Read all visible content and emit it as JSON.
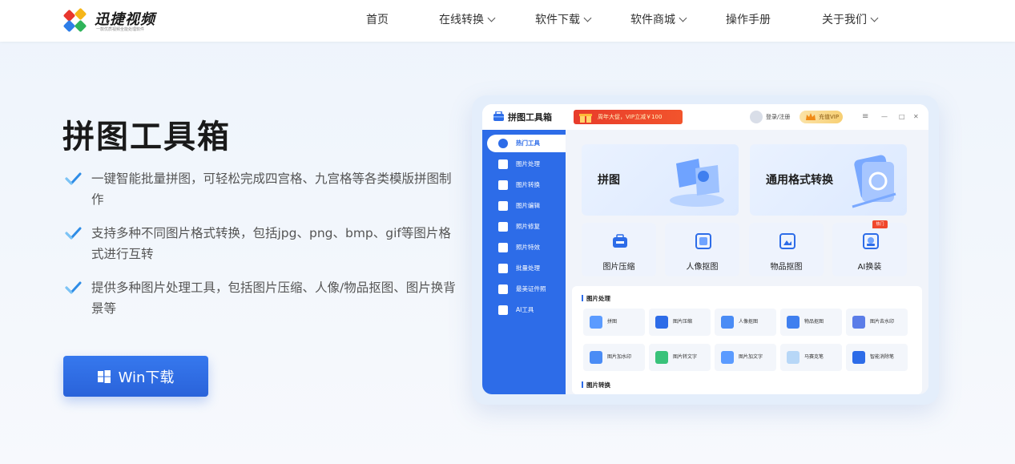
{
  "header": {
    "brand": "迅捷视频",
    "brand_tagline": "一款优质视频全能处理软件",
    "nav": [
      {
        "label": "首页",
        "has_dropdown": false
      },
      {
        "label": "在线转换",
        "has_dropdown": true
      },
      {
        "label": "软件下载",
        "has_dropdown": true
      },
      {
        "label": "软件商城",
        "has_dropdown": true
      },
      {
        "label": "操作手册",
        "has_dropdown": false
      },
      {
        "label": "关于我们",
        "has_dropdown": true
      }
    ]
  },
  "hero": {
    "title": "拼图工具箱",
    "features": [
      "一键智能批量拼图，可轻松完成四宫格、九宫格等各类模版拼图制作",
      "支持多种不同图片格式转换，包括jpg、png、bmp、gif等图片格式进行互转",
      "提供多种图片处理工具，包括图片压缩、人像/物品抠图、图片换背景等"
    ],
    "download_label": "Win下载"
  },
  "app_preview": {
    "title": "拼图工具箱",
    "promo_text": "周年大促，VIP立减￥100",
    "login_text": "登录/注册",
    "vip_text": "充值VIP",
    "window_controls": [
      "≡",
      "—",
      "□",
      "✕"
    ],
    "sidebar": [
      {
        "label": "热门工具",
        "active": true
      },
      {
        "label": "图片处理",
        "active": false
      },
      {
        "label": "图片转换",
        "active": false
      },
      {
        "label": "图片编辑",
        "active": false
      },
      {
        "label": "照片修复",
        "active": false
      },
      {
        "label": "照片特效",
        "active": false
      },
      {
        "label": "批量处理",
        "active": false
      },
      {
        "label": "最美证件照",
        "active": false
      },
      {
        "label": "AI工具",
        "active": false
      }
    ],
    "big_cards": [
      "拼图",
      "通用格式转换"
    ],
    "small_cards": [
      "图片压缩",
      "人像抠图",
      "物品抠图",
      "AI换装"
    ],
    "hot_badge": "热门",
    "section_image_processing": "图片处理",
    "tools_row1": [
      "拼图",
      "图片压缩",
      "人像抠图",
      "物品抠图",
      "图片去水印"
    ],
    "tools_row2": [
      "图片加水印",
      "图片转文字",
      "图片加文字",
      "马赛克笔",
      "智能消除笔"
    ],
    "section_image_convert": "图片转换"
  },
  "colors": {
    "accent": "#2d6ce8",
    "button": "#3070e6",
    "check": "#2e8ce6",
    "promo": "#e83c2b"
  }
}
